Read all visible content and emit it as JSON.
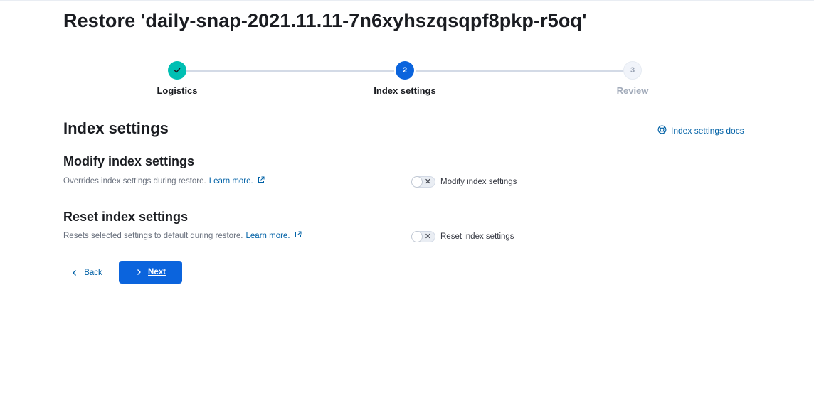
{
  "page": {
    "title": "Restore 'daily-snap-2021.11.11-7n6xyhszqsqpf8pkp-r5oq'"
  },
  "steps": [
    {
      "number": "1",
      "label": "Logistics",
      "status": "complete"
    },
    {
      "number": "2",
      "label": "Index settings",
      "status": "current"
    },
    {
      "number": "3",
      "label": "Review",
      "status": "incomplete"
    }
  ],
  "section": {
    "title": "Index settings",
    "docs_link": "Index settings docs"
  },
  "modify": {
    "title": "Modify index settings",
    "description": "Overrides index settings during restore.",
    "learn_more": "Learn more.",
    "switch_label": "Modify index settings",
    "switch_on": false
  },
  "reset": {
    "title": "Reset index settings",
    "description": "Resets selected settings to default during restore.",
    "learn_more": "Learn more.",
    "switch_label": "Reset index settings",
    "switch_on": false
  },
  "footer": {
    "back_label": "Back",
    "next_label": "Next"
  },
  "colors": {
    "primary": "#0b64dd",
    "success": "#00bfb3",
    "link": "#0061a6"
  }
}
